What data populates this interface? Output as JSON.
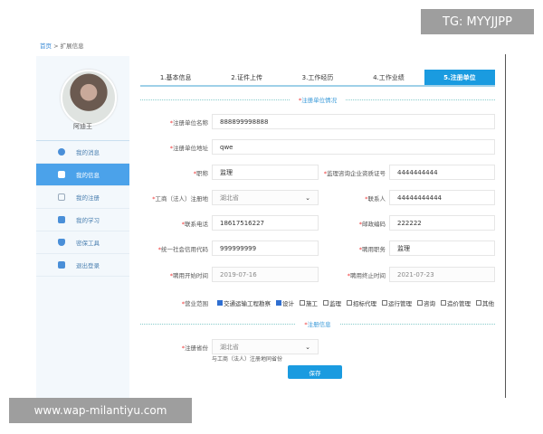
{
  "watermarks": {
    "top": "TG: MYYJJPP",
    "bottom": "www.wap-milantiyu.com"
  },
  "breadcrumb": {
    "home": "首页",
    "sep": ">",
    "current": "扩展信息"
  },
  "user": {
    "name": "阿迪王"
  },
  "sidebar": {
    "items": [
      {
        "label": "我的消息",
        "icon": "message-icon"
      },
      {
        "label": "我的信息",
        "icon": "user-icon",
        "active": true
      },
      {
        "label": "我的注册",
        "icon": "document-icon"
      },
      {
        "label": "我的学习",
        "icon": "book-icon"
      },
      {
        "label": "密保工具",
        "icon": "shield-icon"
      },
      {
        "label": "退出登录",
        "icon": "logout-icon"
      }
    ]
  },
  "tabs": [
    {
      "label": "1.基本信息"
    },
    {
      "label": "2.证件上传"
    },
    {
      "label": "3.工作经历"
    },
    {
      "label": "4.工作业绩"
    },
    {
      "label": "5.注册单位",
      "active": true
    }
  ],
  "section1": "注册单位情况",
  "fields": {
    "unit_name": {
      "label": "注册单位名称",
      "value": "888899998888"
    },
    "unit_address": {
      "label": "注册单位地址",
      "value": "qwe"
    },
    "title": {
      "label": "职称",
      "value": "监理"
    },
    "qualification_no": {
      "label": "监理咨询企业资质证号",
      "value": "4444444444"
    },
    "reg_place": {
      "label": "工商（法人）注册地",
      "value": "湖北省"
    },
    "contact": {
      "label": "联系人",
      "value": "44444444444"
    },
    "phone": {
      "label": "联系电话",
      "value": "18617516227"
    },
    "postcode": {
      "label": "邮政编码",
      "value": "222222"
    },
    "credit_code": {
      "label": "统一社会信用代码",
      "value": "999999999"
    },
    "position": {
      "label": "聘用职务",
      "value": "监理"
    },
    "start_date": {
      "label": "聘用开始时间",
      "value": "2019-07-16"
    },
    "end_date": {
      "label": "聘用终止时间",
      "value": "2021-07-23"
    }
  },
  "scope": {
    "label": "营业范围",
    "options": [
      {
        "label": "交通运输工程勘察",
        "checked": true
      },
      {
        "label": "设计",
        "checked": true
      },
      {
        "label": "施工",
        "checked": false
      },
      {
        "label": "监理",
        "checked": false
      },
      {
        "label": "招标代理",
        "checked": false
      },
      {
        "label": "运行管理",
        "checked": false
      },
      {
        "label": "咨询",
        "checked": false
      },
      {
        "label": "造价管理",
        "checked": false
      },
      {
        "label": "其他",
        "checked": false
      }
    ]
  },
  "section2": "注册信息",
  "reg_province": {
    "label": "注册省份",
    "value": "湖北省",
    "hint": "与工商（法人）注册地同省份"
  },
  "save_label": "保存",
  "colors": {
    "accent": "#1a9be0",
    "sidebar_active": "#4ba2ea",
    "required": "#e33333"
  }
}
